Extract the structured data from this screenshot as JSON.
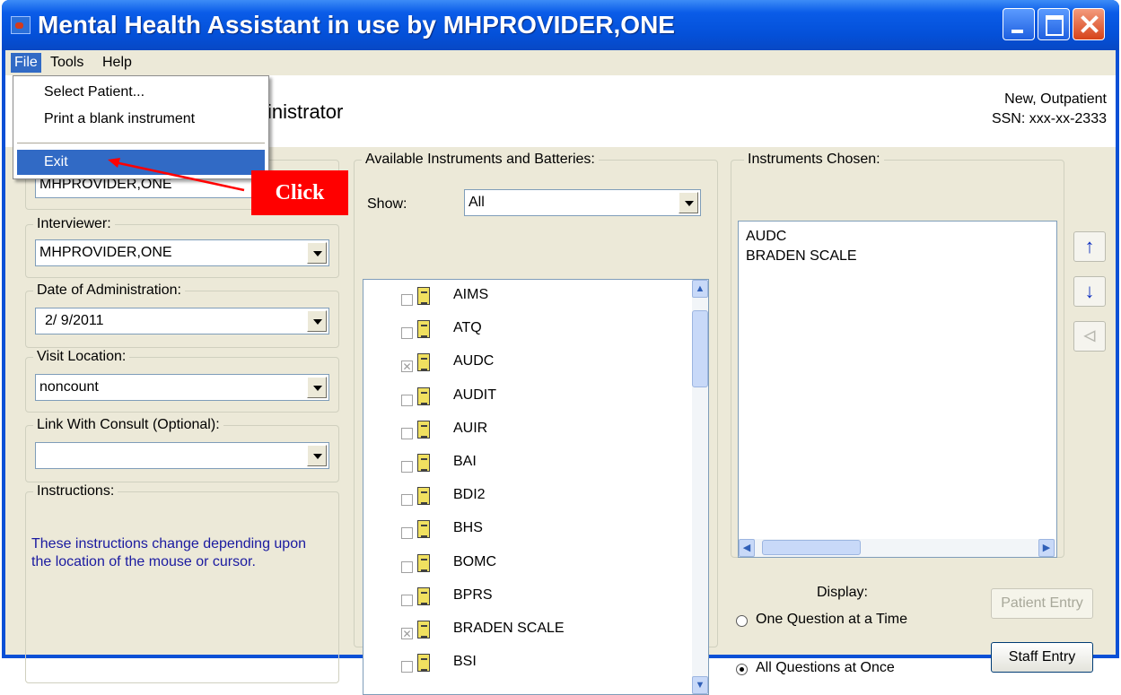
{
  "window": {
    "title": "Mental Health Assistant in use by MHPROVIDER,ONE"
  },
  "menubar": {
    "file": "File",
    "tools": "Tools",
    "help": "Help"
  },
  "file_menu": {
    "items": [
      "Select Patient...",
      "Print a blank instrument",
      "Exit"
    ],
    "selected": "Exit"
  },
  "header": {
    "title_fragment": "inistrator",
    "patient_type": "New, Outpatient",
    "ssn": "SSN: xxx-xx-2333"
  },
  "left_panel": {
    "ordered_by_value": "MHPROVIDER,ONE",
    "interviewer_label": "Interviewer:",
    "interviewer_value": "MHPROVIDER,ONE",
    "date_label": "Date of Administration:",
    "date_value": "2/ 9/2011",
    "visit_label": "Visit Location:",
    "visit_value": "noncount",
    "consult_label": "Link With Consult (Optional):",
    "consult_value": "",
    "instructions_label": "Instructions:",
    "instructions_text": "These instructions change depending upon the location of the mouse or cursor."
  },
  "available": {
    "label": "Available Instruments and Batteries:",
    "show_label": "Show:",
    "show_value": "All",
    "instruments": [
      {
        "name": "AIMS",
        "checked": false
      },
      {
        "name": "ATQ",
        "checked": false
      },
      {
        "name": "AUDC",
        "checked": true
      },
      {
        "name": "AUDIT",
        "checked": false
      },
      {
        "name": "AUIR",
        "checked": false
      },
      {
        "name": "BAI",
        "checked": false
      },
      {
        "name": "BDI2",
        "checked": false
      },
      {
        "name": "BHS",
        "checked": false
      },
      {
        "name": "BOMC",
        "checked": false
      },
      {
        "name": "BPRS",
        "checked": false
      },
      {
        "name": "BRADEN SCALE",
        "checked": true
      },
      {
        "name": "BSI",
        "checked": false
      }
    ]
  },
  "chosen": {
    "label": "Instruments Chosen:",
    "items": [
      "AUDC",
      "BRADEN SCALE"
    ]
  },
  "display": {
    "label": "Display:",
    "option_one": "One Question at a Time",
    "option_all": "All Questions at Once",
    "selected": "All Questions at Once"
  },
  "buttons": {
    "patient_entry": "Patient Entry",
    "staff_entry": "Staff Entry"
  },
  "annotation": {
    "text": "Click",
    "color": "#ff0000"
  },
  "colors": {
    "title_bar": "#0a50d6",
    "menu_highlight": "#316ac5",
    "instructions_text": "#1a1aa0"
  },
  "icons": [
    "app-icon",
    "minimize-icon",
    "maximize-icon",
    "close-icon",
    "move-up-arrow-icon",
    "move-down-arrow-icon",
    "remove-arrow-icon",
    "instrument-doc-icon",
    "chevron-down-icon"
  ]
}
